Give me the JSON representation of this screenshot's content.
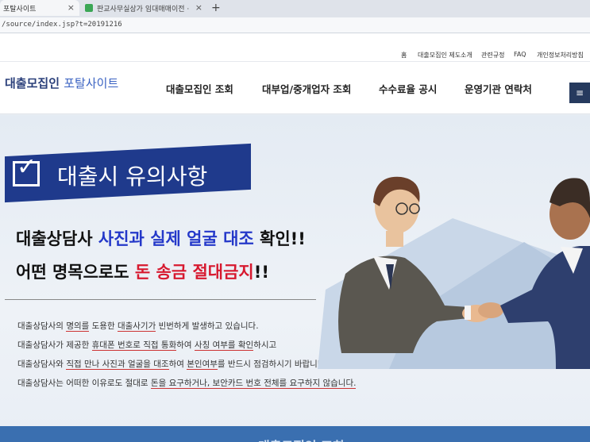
{
  "browser": {
    "tabs": [
      {
        "label": "포탈사이트",
        "active": true
      },
      {
        "label": "판교사무실상가 임대매매이전 ·",
        "active": false
      }
    ],
    "new_tab": "+",
    "close_glyph": "×",
    "url": "/source/index.jsp?t=20191216"
  },
  "utility_links": [
    "홈",
    "대출모집인 제도소개",
    "관련규정",
    "FAQ",
    "개인정보처리방침"
  ],
  "header": {
    "logo_main": "대출모집인",
    "logo_sub": "포탈사이트",
    "nav": [
      "대출모집인 조회",
      "대부업/중개업자 조회",
      "수수료율 공시",
      "운영기관 연락처"
    ],
    "menu_icon": "≡"
  },
  "hero": {
    "title": "대출시 유의사항",
    "line1": {
      "pre": "대출상담사 ",
      "highlight": "사진과 실제 얼굴 대조",
      "post": " 확인!!"
    },
    "line2": {
      "pre": "어떤 명목으로도 ",
      "highlight": "돈 송금 절대금지",
      "post": "!!"
    },
    "notices": [
      {
        "parts": [
          "대출상담사의 ",
          "명의를",
          " 도용한 ",
          "대출사기가",
          "  빈번하게 발생하고 있습니다."
        ]
      },
      {
        "parts": [
          "대출상담사가 제공한 ",
          "휴대폰 번호로 직접 통화",
          "하여 ",
          "사칭 여부를 확인",
          "하시고"
        ]
      },
      {
        "parts": [
          "대출상담사와 ",
          "직접 만나 사진과 얼굴을 대조",
          "하여 ",
          "본인여부",
          "를 반드시 점검하시기 바랍니다."
        ]
      },
      {
        "parts": [
          "대출상담사는 어떠한 이유로도 절대로 ",
          "돈을 요구하거나, 보안카드 번호 전체를 요구하지 않습니다.",
          "",
          "",
          ""
        ]
      }
    ],
    "bottom_heading": "대출모집인 조회"
  },
  "colors": {
    "brand_navy": "#1f3a8c",
    "accent_blue": "#2438c9",
    "accent_red": "#d7192f"
  }
}
